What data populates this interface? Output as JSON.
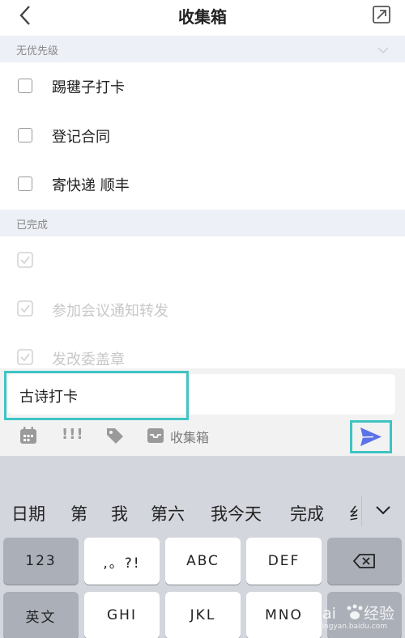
{
  "header": {
    "title": "收集箱"
  },
  "sections": {
    "no_priority": "无优先级",
    "completed": "已完成"
  },
  "tasks": [
    {
      "text": "踢毽子打卡"
    },
    {
      "text": "登记合同"
    },
    {
      "text": "寄快递 顺丰"
    }
  ],
  "done_tasks": [
    {
      "text": ""
    },
    {
      "text": "参加会议通知转发"
    },
    {
      "text": "发改委盖章"
    }
  ],
  "input": {
    "value": "古诗打卡"
  },
  "toolbar": {
    "priority": "!!!",
    "list_label": "收集箱"
  },
  "candidates": [
    "日期",
    "第",
    "我",
    "第六",
    "我今天",
    "完成",
    "纟"
  ],
  "keys": {
    "row1": [
      "123",
      ",。?!",
      "ABC",
      "DEF"
    ],
    "row2": [
      "英文",
      "GHI",
      "JKL",
      "MNO"
    ]
  },
  "watermark": {
    "brand": "Bai",
    "suffix": "经验",
    "url": "jingyan.baidu.com"
  },
  "colors": {
    "accent": "#5b73e8",
    "highlight": "#3fc3c3",
    "section_bg": "#eef0f8",
    "keyboard_bg": "#d4d6dd"
  }
}
